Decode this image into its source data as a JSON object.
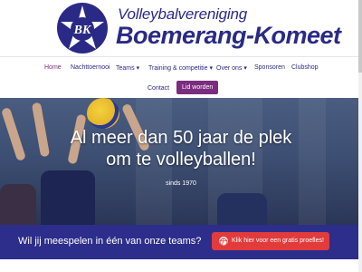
{
  "brand": {
    "small": "Volleybalvereniging",
    "big": "Boemerang-Komeet",
    "logo_text": "BK"
  },
  "nav": {
    "items": [
      "Home",
      "Nachttoernooi",
      "Teams",
      "Training & competitie",
      "Over ons",
      "Sponsoren",
      "Clubshop",
      "Contact"
    ],
    "dropdown_marker": "▾",
    "cta": "Lid worden"
  },
  "hero": {
    "title_line1": "Al meer dan 50 jaar de plek",
    "title_line2": "om te volleyballen!",
    "subtitle": "sinds 1970"
  },
  "band": {
    "question": "Wil jij meespelen in één van onze teams?",
    "button": "Klik hier voor een gratis proefles!"
  },
  "colors": {
    "brand_navy": "#2a2a86",
    "accent_purple": "#7b2c7e",
    "band_bg": "#2d2d8c",
    "button_red": "#e23b3b"
  }
}
